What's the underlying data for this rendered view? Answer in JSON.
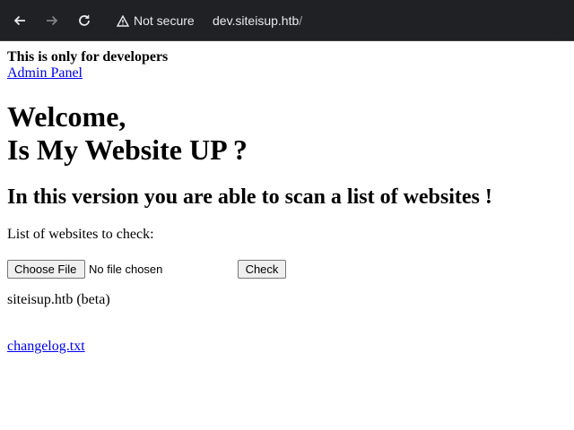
{
  "browser": {
    "security_text": "Not secure",
    "url_host": "dev.siteisup.htb",
    "url_path": "/",
    "icons": [
      "back-arrow-icon",
      "forward-arrow-icon",
      "reload-icon",
      "warning-triangle-icon"
    ]
  },
  "page": {
    "dev_note": "This is only for developers",
    "admin_link": "Admin Panel",
    "heading_line1": "Welcome,",
    "heading_line2": "Is My Website UP ?",
    "subheading": "In this version you are able to scan a list of websites !",
    "list_label": "List of websites to check:",
    "file_button": "Choose File",
    "file_status": "No file chosen",
    "check_button": "Check",
    "beta_text": "siteisup.htb (beta)",
    "changelog_link": "changelog.txt"
  },
  "colors": {
    "chrome_bg": "#202124",
    "link": "#0000ee",
    "page_bg": "#ffffff"
  }
}
